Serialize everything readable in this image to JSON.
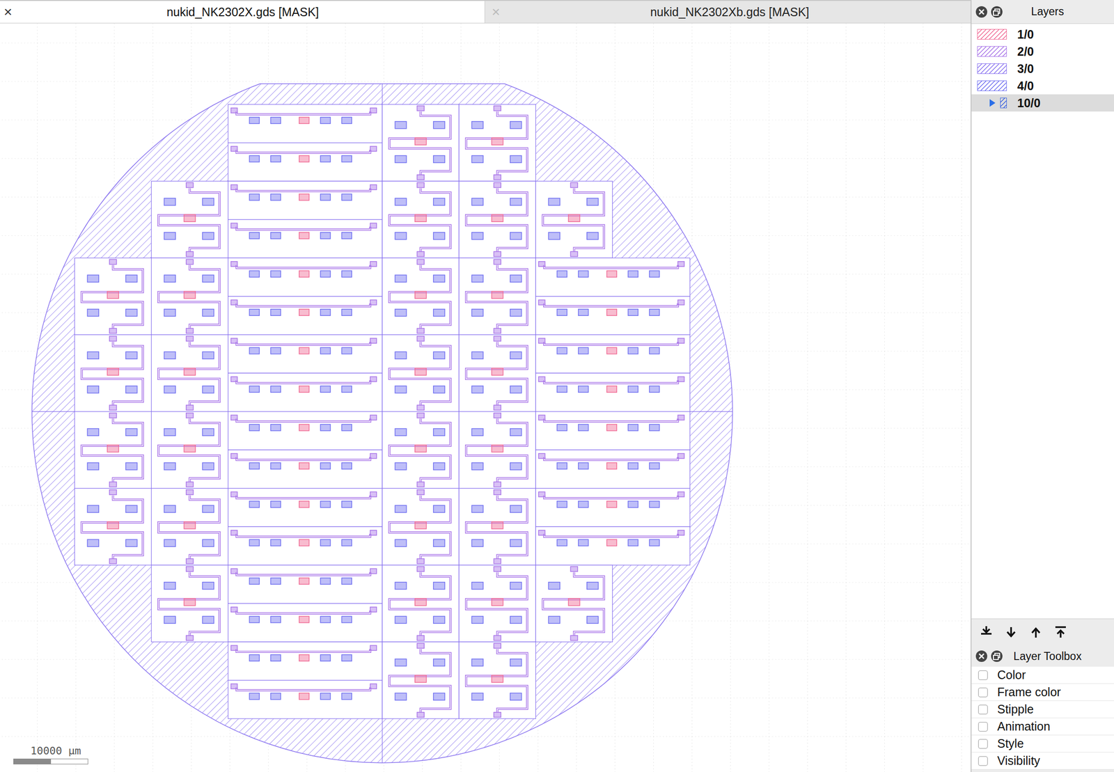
{
  "tabs": [
    {
      "label": "nukid_NK2302X.gds [MASK]",
      "close": "×",
      "selected": true
    },
    {
      "label": "nukid_NK2302Xb.gds [MASK]",
      "close": "×",
      "selected": false
    }
  ],
  "layers_panel": {
    "title": "Layers",
    "layers": [
      {
        "name": "1/0",
        "kind": "layer",
        "color": "#f06a94",
        "selected": false
      },
      {
        "name": "2/0",
        "kind": "layer",
        "color": "#a874e8",
        "selected": false
      },
      {
        "name": "3/0",
        "kind": "layer",
        "color": "#8a74f0",
        "selected": false
      },
      {
        "name": "4/0",
        "kind": "layer",
        "color": "#6f6ff0",
        "selected": false
      },
      {
        "name": "10/0",
        "kind": "group",
        "color": "#3b62e0",
        "selected": true,
        "expanded": false
      }
    ]
  },
  "toolbox": {
    "title": "Layer Toolbox",
    "items": [
      {
        "label": "Color",
        "checked": false
      },
      {
        "label": "Frame color",
        "checked": false
      },
      {
        "label": "Stipple",
        "checked": false
      },
      {
        "label": "Animation",
        "checked": false
      },
      {
        "label": "Style",
        "checked": false
      },
      {
        "label": "Visibility",
        "checked": false
      }
    ]
  },
  "scale_bar": {
    "label": "10000 µm"
  }
}
